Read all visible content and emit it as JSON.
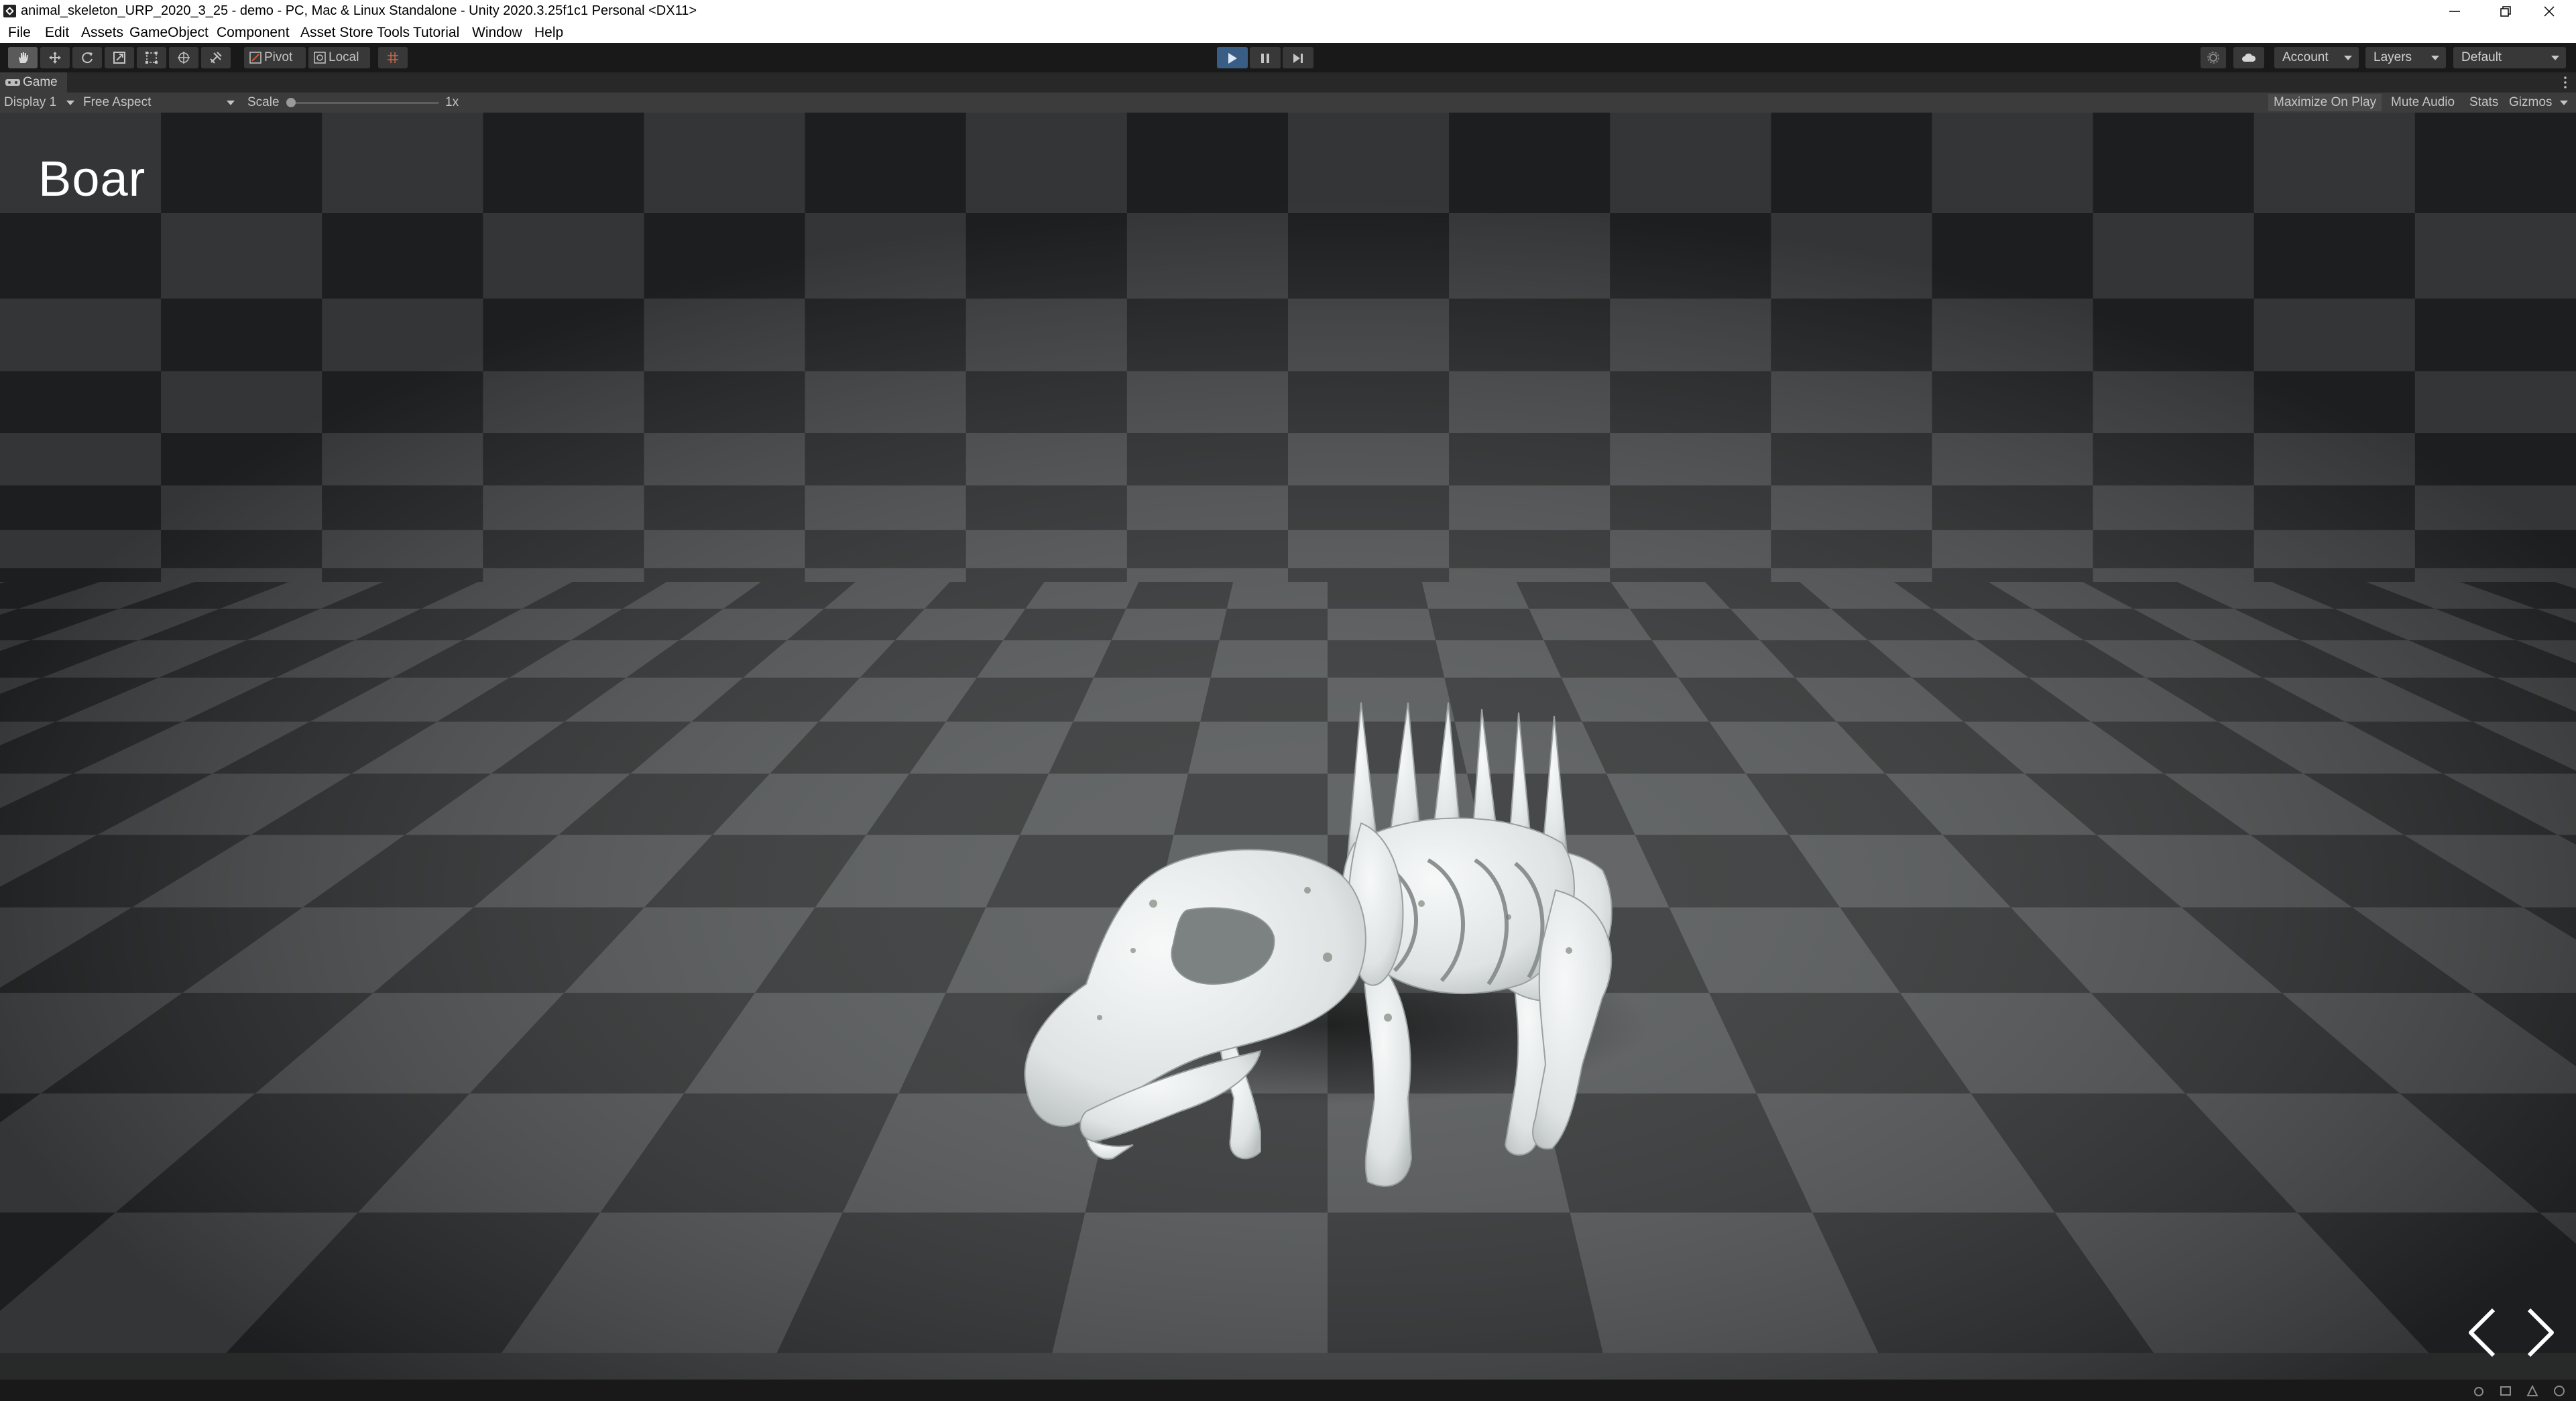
{
  "window": {
    "title": "animal_skeleton_URP_2020_3_25 - demo - PC, Mac & Linux Standalone - Unity 2020.3.25f1c1 Personal <DX11>"
  },
  "menu": [
    "File",
    "Edit",
    "Assets",
    "GameObject",
    "Component",
    "Asset Store Tools",
    "Tutorial",
    "Window",
    "Help"
  ],
  "toolbar": {
    "tools": [
      "hand-tool",
      "move-tool",
      "rotate-tool",
      "scale-tool",
      "rect-tool",
      "transform-tool",
      "custom-tool"
    ],
    "pivot_label": "Pivot",
    "local_label": "Local",
    "account_label": "Account",
    "layers_label": "Layers",
    "layout_label": "Default",
    "play_active": true
  },
  "tab": {
    "label": "Game"
  },
  "game_toolbar": {
    "display": "Display 1",
    "aspect": "Free Aspect",
    "scale_label": "Scale",
    "scale_value": "1x",
    "maximize_on_play": "Maximize On Play",
    "mute_audio": "Mute Audio",
    "stats": "Stats",
    "gizmos": "Gizmos"
  },
  "scene": {
    "title": "Boar",
    "prev_icon": "chevron-left-icon",
    "next_icon": "chevron-right-icon"
  },
  "colors": {
    "play_accent": "#3a5d86",
    "checker_dark": "#2c2e2f",
    "checker_light": "#4f5253",
    "bone": "#e9ecec"
  }
}
